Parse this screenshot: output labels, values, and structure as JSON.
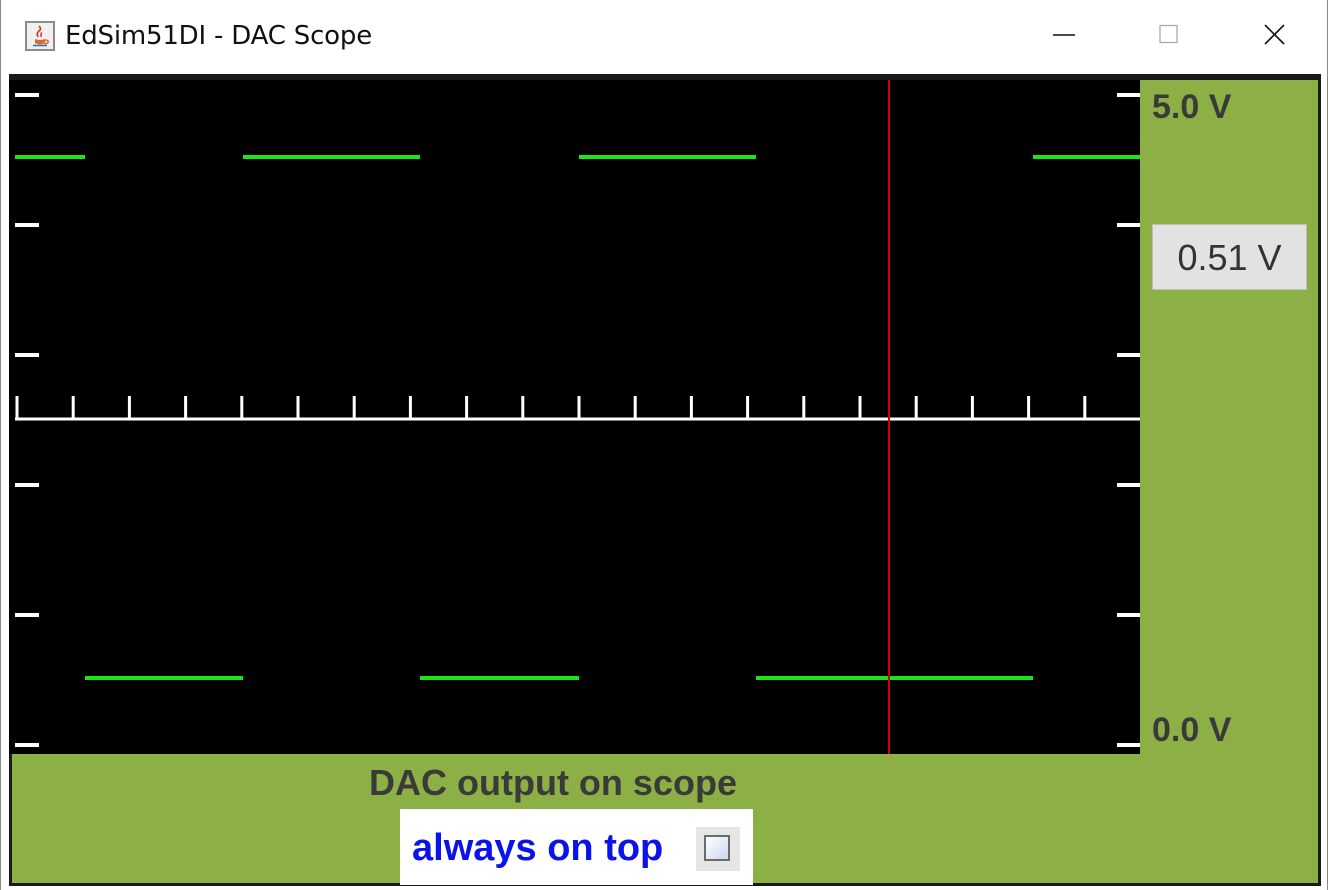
{
  "window": {
    "title": "EdSim51DI - DAC Scope"
  },
  "icons": {
    "app": "java-coffee-cup-icon",
    "minimize": "minimize-icon",
    "maximize": "maximize-icon",
    "close": "close-icon"
  },
  "scope": {
    "max_label": "5.0 V",
    "min_label": "0.0 V",
    "readout": "0.51 V",
    "caption": "DAC output on scope",
    "always_on_top_label": "always on top",
    "always_on_top_checked": false
  },
  "colors": {
    "panel_background": "#8db046",
    "scope_background": "#000000",
    "trace": "#19e619",
    "cursor": "#d00000",
    "axis": "#ffffff",
    "always_on_top_text": "#0a14e8"
  }
}
